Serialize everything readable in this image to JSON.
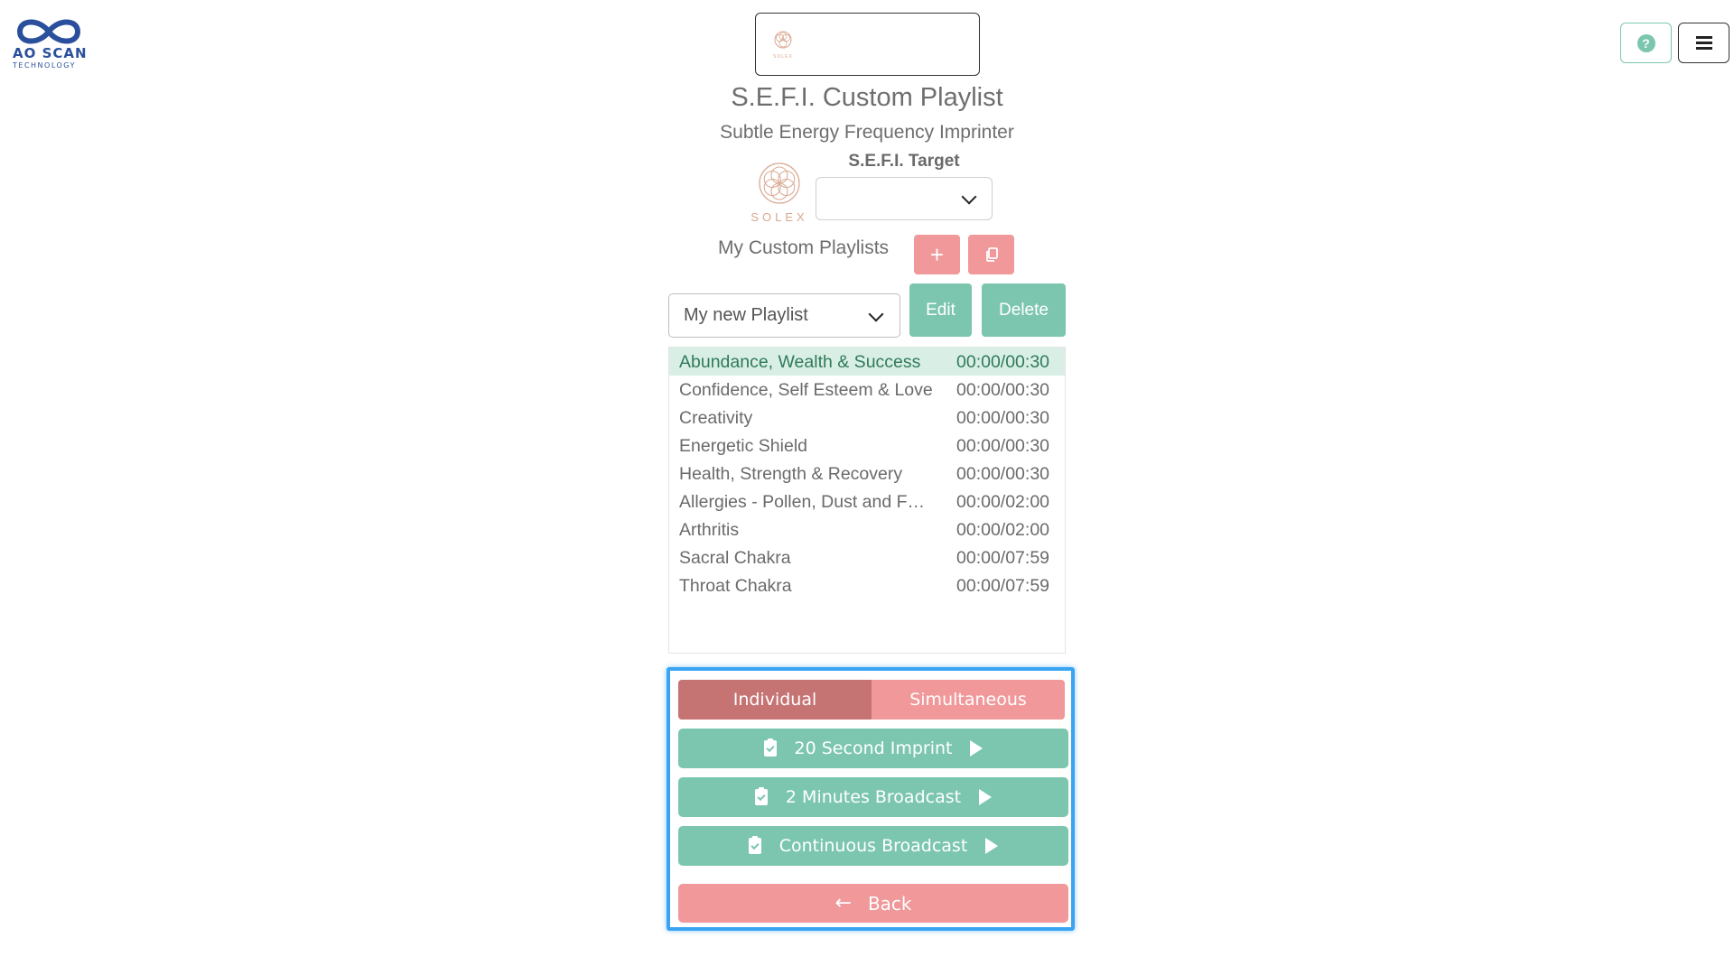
{
  "brand": {
    "name": "AO SCAN",
    "sub": "TECHNOLOGY",
    "color": "#2a4f9c"
  },
  "header": {
    "help_label": "?",
    "menu_icon": "hamburger-icon"
  },
  "device": {
    "logo_word": "SOLEX"
  },
  "page": {
    "title": "S.E.F.I.  Custom Playlist",
    "subtitle": "Subtle Energy Frequency Imprinter"
  },
  "target": {
    "logo_word": "SOLEX",
    "label": "S.E.F.I. Target",
    "value": ""
  },
  "playlists": {
    "label": "My Custom Playlists",
    "add_label": "+",
    "selected": "My new Playlist",
    "edit_label": "Edit",
    "delete_label": "Delete",
    "items": [
      {
        "name": "Abundance, Wealth & Success",
        "time": "00:00/00:30",
        "active": true
      },
      {
        "name": "Confidence, Self Esteem & Love",
        "time": "00:00/00:30"
      },
      {
        "name": "Creativity",
        "time": "00:00/00:30"
      },
      {
        "name": "Energetic Shield",
        "time": "00:00/00:30"
      },
      {
        "name": "Health, Strength & Recovery",
        "time": "00:00/00:30"
      },
      {
        "name": "Allergies - Pollen, Dust and F…",
        "time": "00:00/02:00"
      },
      {
        "name": "Arthritis",
        "time": "00:00/02:00"
      },
      {
        "name": "Sacral Chakra",
        "time": "00:00/07:59"
      },
      {
        "name": "Throat Chakra",
        "time": "00:00/07:59"
      }
    ]
  },
  "mode": {
    "individual": "Individual",
    "simultaneous": "Simultaneous"
  },
  "actions": {
    "imprint": "20 Second Imprint",
    "broadcast2": "2 Minutes Broadcast",
    "continuous": "Continuous Broadcast",
    "back": "Back"
  },
  "colors": {
    "green": "#7cc6b0",
    "pink": "#f0989a",
    "rose": "#c67373",
    "highlight": "#3aa4f2"
  }
}
